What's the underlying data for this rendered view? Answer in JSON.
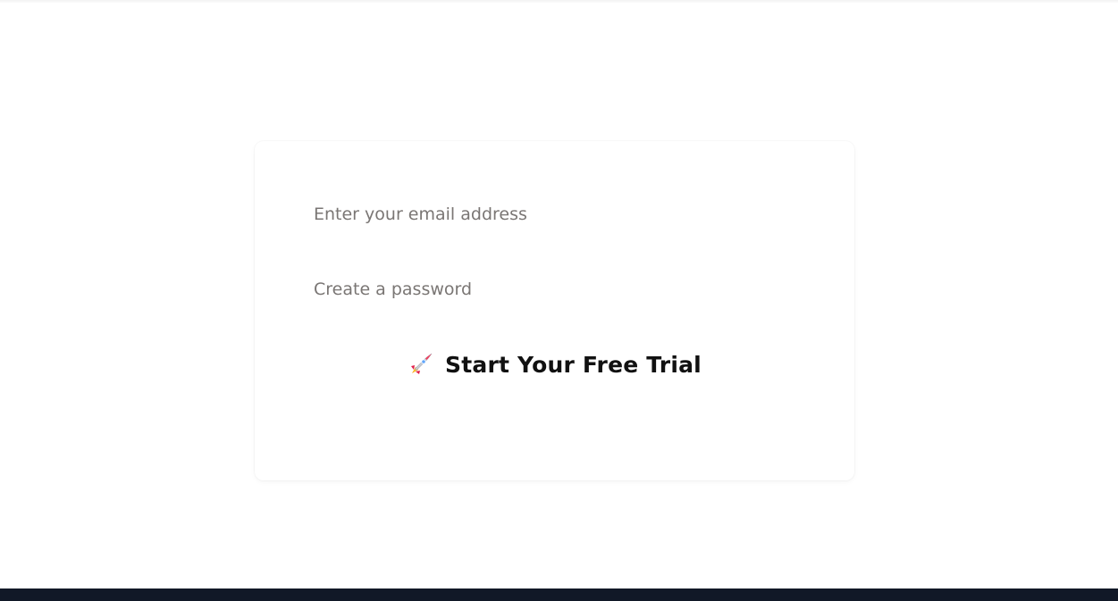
{
  "signup": {
    "email_placeholder": "Enter your email address",
    "password_placeholder": "Create a password",
    "cta_label": "Start Your Free Trial",
    "cta_icon": "rocket-icon"
  },
  "colors": {
    "footer_background": "#111827",
    "placeholder_text": "#7a7674",
    "cta_text": "#111111"
  }
}
